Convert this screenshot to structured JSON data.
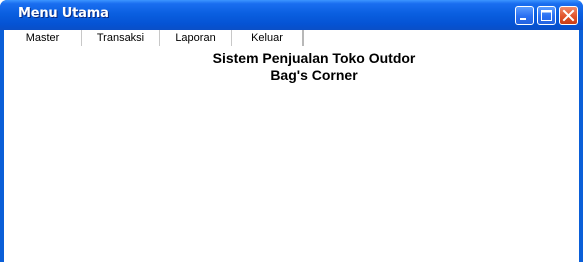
{
  "window": {
    "title": "Menu Utama",
    "controls": [
      "minimize-icon",
      "maximize-icon",
      "close-icon"
    ]
  },
  "menu": {
    "items": [
      {
        "label": "Master"
      },
      {
        "label": "Transaksi"
      },
      {
        "label": "Laporan"
      },
      {
        "label": "Keluar"
      }
    ]
  },
  "content": {
    "heading_line1": "Sistem Penjualan Toko Outdor",
    "heading_line2": "Bag's Corner"
  },
  "colors": {
    "titlebar": "#0553d4",
    "close_button": "#e2552c",
    "background": "#ffffff"
  }
}
